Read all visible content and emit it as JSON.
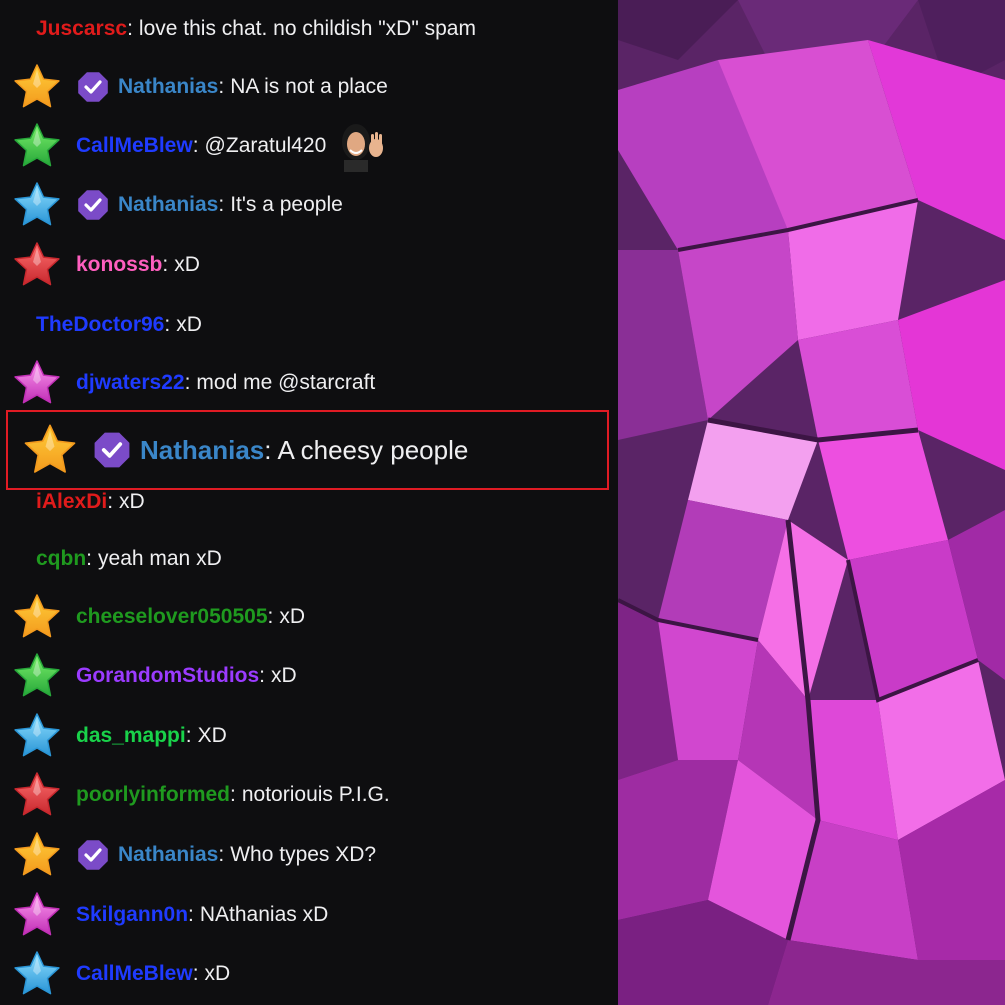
{
  "colors": {
    "background": "#0e0e10",
    "message_text": "#efeff1",
    "highlight_border": "#e01b24",
    "verified_badge": "#7b4bc8"
  },
  "chat": {
    "messages": [
      {
        "username": "Juscarsc",
        "user_color": "#e01b1b",
        "badge": null,
        "verified": false,
        "text": "love this chat. no childish \"xD\" spam"
      },
      {
        "username": "Nathanias",
        "user_color": "#3a86c8",
        "badge": "gold-star-badge",
        "verified": true,
        "text": "NA is not a place"
      },
      {
        "username": "CallMeBlew",
        "user_color": "#1f3bff",
        "badge": "green-star-badge",
        "verified": false,
        "text": "@Zaratul420",
        "emote": "waving-woman-emote"
      },
      {
        "username": "Nathanias",
        "user_color": "#3a86c8",
        "badge": "blue-star-badge",
        "verified": true,
        "text": "It's a people"
      },
      {
        "username": "konossb",
        "user_color": "#ff5fbf",
        "badge": "red-star-badge",
        "verified": false,
        "text": "xD"
      },
      {
        "username": "TheDoctor96",
        "user_color": "#1f3bff",
        "badge": null,
        "verified": false,
        "text": "xD"
      },
      {
        "username": "djwaters22",
        "user_color": "#1f3bff",
        "badge": "pink-star-badge",
        "verified": false,
        "text": "mod me @starcraft"
      },
      {
        "username": "Nathanias",
        "user_color": "#3a86c8",
        "badge": "gold-star-badge",
        "verified": true,
        "text": "A cheesy people",
        "highlighted": true
      },
      {
        "username": "iAlexDi",
        "user_color": "#e01b1b",
        "badge": null,
        "verified": false,
        "text": "xD"
      },
      {
        "username": "cqbn",
        "user_color": "#1f9a1f",
        "badge": null,
        "verified": false,
        "text": "yeah man xD"
      },
      {
        "username": "cheeselover050505",
        "user_color": "#1f9a1f",
        "badge": "gold-star-badge",
        "verified": false,
        "text": "xD"
      },
      {
        "username": "GorandomStudios",
        "user_color": "#9b3bff",
        "badge": "green-star-badge",
        "verified": false,
        "text": "xD"
      },
      {
        "username": "das_mappi",
        "user_color": "#19d24a",
        "badge": "blue-star-badge",
        "verified": false,
        "text": "XD"
      },
      {
        "username": "poorlyinformed",
        "user_color": "#1f9a1f",
        "badge": "red-star-badge",
        "verified": false,
        "text": "notoriouis P.I.G."
      },
      {
        "username": "Nathanias",
        "user_color": "#3a86c8",
        "badge": "gold-star-badge",
        "verified": true,
        "text": "Who types XD?"
      },
      {
        "username": "Skilgann0n",
        "user_color": "#1f3bff",
        "badge": "pink-star-badge",
        "verified": false,
        "text": "NAthanias xD"
      },
      {
        "username": "CallMeBlew",
        "user_color": "#1f3bff",
        "badge": "blue-star-badge",
        "verified": false,
        "text": "xD"
      }
    ]
  },
  "art": {
    "subject": "magenta-crystal-star-artwork"
  }
}
